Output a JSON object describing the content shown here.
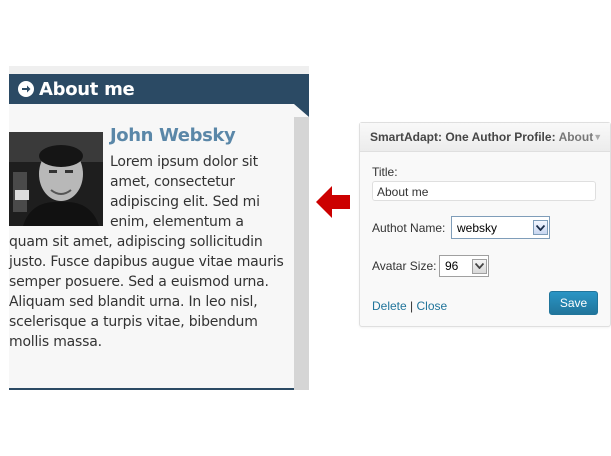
{
  "widget": {
    "title": "About me",
    "author_name": "John Websky",
    "bio": "Lorem ipsum dolor sit amet, consectetur adipiscing elit. Sed mi enim, elementum a quam sit amet, adipiscing sollicitudin justo. Fusce dapibus augue vitae mauris semper posuere. Sed a euismod urna. Aliquam sed blandit urna. In leo nisl, scelerisque a turpis vitae, bibendum mollis massa.",
    "header_color": "#2b4a64",
    "name_color": "#5a87a8"
  },
  "arrow": {
    "color": "#cc0000"
  },
  "panel": {
    "title": "SmartAdapt: One Author Profile:",
    "subtitle": "About",
    "title_label": "Title:",
    "title_value": "About me",
    "author_label": "Authot Name:",
    "author_value": "websky",
    "avatar_label": "Avatar Size:",
    "avatar_value": "96",
    "delete_label": "Delete",
    "separator": "|",
    "close_label": "Close",
    "save_label": "Save",
    "accent_color": "#21759b"
  }
}
